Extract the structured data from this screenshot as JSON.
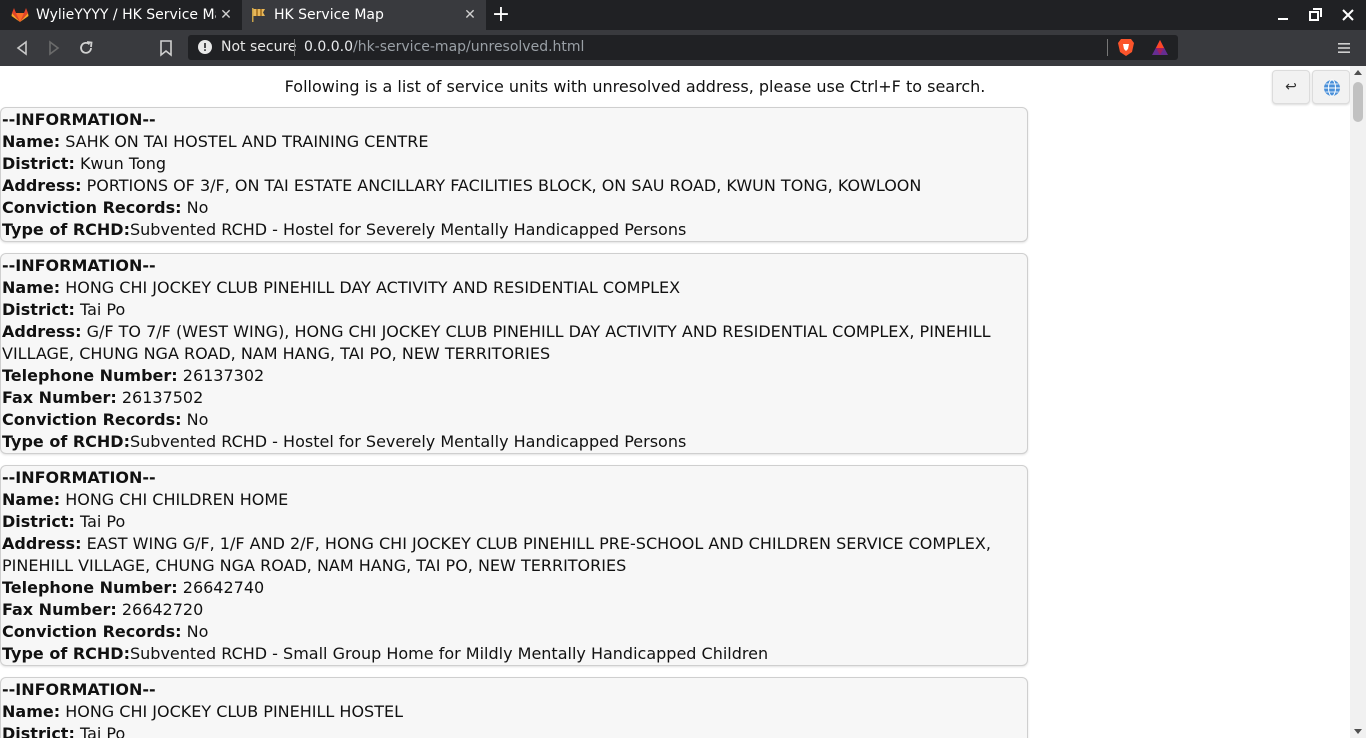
{
  "browser": {
    "tabs": [
      {
        "title": "WylieYYYY / HK Service Map",
        "icon": "gitlab-icon"
      },
      {
        "title": "HK Service Map",
        "icon": "flag-icon"
      }
    ],
    "security_label": "Not secure",
    "url_host": "0.0.0.0",
    "url_path": "/hk-service-map/unresolved.html"
  },
  "page": {
    "header_note": "Following is a list of service units with unresolved address, please use Ctrl+F to search.",
    "back_button": "↩",
    "section_heading": "--INFORMATION--",
    "labels": {
      "name": "Name:",
      "district": "District:",
      "address": "Address:",
      "telephone": "Telephone Number:",
      "fax": "Fax Number:",
      "conviction": "Conviction Records:",
      "type": "Type of RCHD:"
    },
    "records": [
      {
        "name": "SAHK ON TAI HOSTEL AND TRAINING CENTRE",
        "district": "Kwun Tong",
        "address": "PORTIONS OF 3/F, ON TAI ESTATE ANCILLARY FACILITIES BLOCK, ON SAU ROAD, KWUN TONG, KOWLOON",
        "conviction": "No",
        "type": "Subvented RCHD - Hostel for Severely Mentally Handicapped Persons"
      },
      {
        "name": "HONG CHI JOCKEY CLUB PINEHILL DAY ACTIVITY AND RESIDENTIAL COMPLEX",
        "district": "Tai Po",
        "address": "G/F TO 7/F (WEST WING), HONG CHI JOCKEY CLUB PINEHILL DAY ACTIVITY AND RESIDENTIAL COMPLEX, PINEHILL VILLAGE, CHUNG NGA ROAD, NAM HANG, TAI PO, NEW TERRITORIES",
        "telephone": "26137302",
        "fax": "26137502",
        "conviction": "No",
        "type": "Subvented RCHD - Hostel for Severely Mentally Handicapped Persons"
      },
      {
        "name": "HONG CHI CHILDREN HOME",
        "district": "Tai Po",
        "address": "EAST WING G/F, 1/F AND 2/F, HONG CHI JOCKEY CLUB PINEHILL PRE-SCHOOL AND CHILDREN SERVICE COMPLEX, PINEHILL VILLAGE, CHUNG NGA ROAD, NAM HANG, TAI PO, NEW TERRITORIES",
        "telephone": "26642740",
        "fax": "26642720",
        "conviction": "No",
        "type": "Subvented RCHD - Small Group Home for Mildly Mentally Handicapped Children"
      },
      {
        "name": "HONG CHI JOCKEY CLUB PINEHILL HOSTEL",
        "district": "Tai Po"
      }
    ]
  },
  "colors": {
    "tabbar": "#202124",
    "toolbar": "#393a3e",
    "card_bg": "#f7f7f7",
    "card_border": "#cfcfcf"
  }
}
